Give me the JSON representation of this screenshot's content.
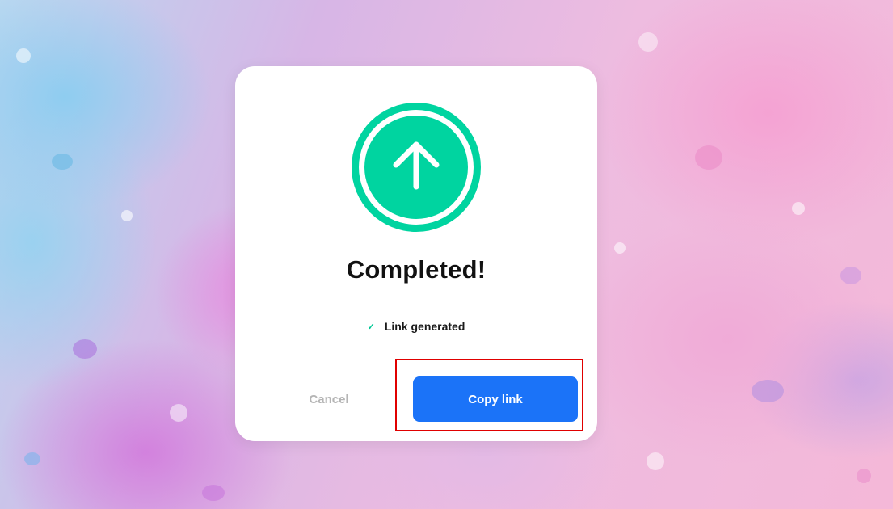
{
  "dialog": {
    "title": "Completed!",
    "status_icon": "check-icon",
    "status_text": "Link generated",
    "hero_icon": "arrow-up-icon",
    "accent_color": "#00d4a0",
    "cancel_label": "Cancel",
    "copy_label": "Copy link",
    "primary_color": "#1b73f8",
    "highlight_color": "#e00000"
  }
}
